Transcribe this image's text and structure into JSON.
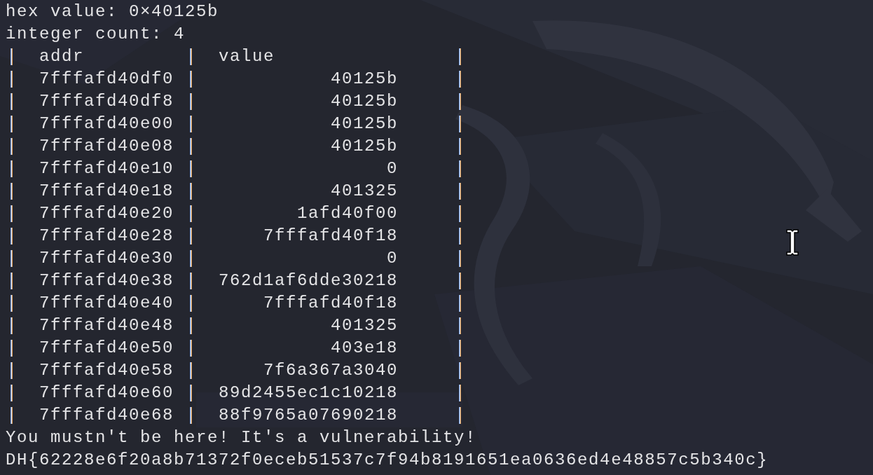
{
  "output_before": [
    "hex value: 0×40125b",
    "integer count: 4"
  ],
  "table": {
    "columns": [
      "addr",
      "value"
    ],
    "rows": [
      {
        "addr": "7fffafd40df0",
        "value": "40125b"
      },
      {
        "addr": "7fffafd40df8",
        "value": "40125b"
      },
      {
        "addr": "7fffafd40e00",
        "value": "40125b"
      },
      {
        "addr": "7fffafd40e08",
        "value": "40125b"
      },
      {
        "addr": "7fffafd40e10",
        "value": "0"
      },
      {
        "addr": "7fffafd40e18",
        "value": "401325"
      },
      {
        "addr": "7fffafd40e20",
        "value": "1afd40f00"
      },
      {
        "addr": "7fffafd40e28",
        "value": "7fffafd40f18"
      },
      {
        "addr": "7fffafd40e30",
        "value": "0"
      },
      {
        "addr": "7fffafd40e38",
        "value": "762d1af6dde30218"
      },
      {
        "addr": "7fffafd40e40",
        "value": "7fffafd40f18"
      },
      {
        "addr": "7fffafd40e48",
        "value": "401325"
      },
      {
        "addr": "7fffafd40e50",
        "value": "403e18"
      },
      {
        "addr": "7fffafd40e58",
        "value": "7f6a367a3040"
      },
      {
        "addr": "7fffafd40e60",
        "value": "89d2455ec1c10218"
      },
      {
        "addr": "7fffafd40e68",
        "value": "88f9765a07690218"
      }
    ]
  },
  "output_after": [
    "You mustn't be here! It's a vulnerability!",
    "DH{62228e6f20a8b71372f0eceb51537c7f94b8191651ea0636ed4e48857c5b340c}"
  ]
}
